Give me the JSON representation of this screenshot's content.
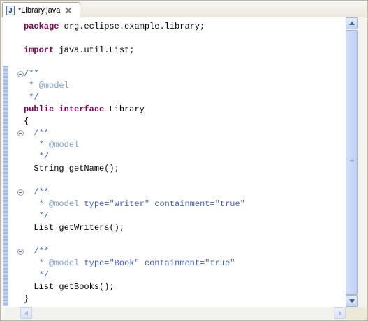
{
  "tab": {
    "icon": "java-file-icon",
    "icon_glyph": "J",
    "label": "*Library.java"
  },
  "code_lines": [
    [
      {
        "t": "package",
        "c": "kw"
      },
      {
        "t": " org.eclipse.example.library;",
        "c": "plain"
      }
    ],
    [],
    [
      {
        "t": "import",
        "c": "kw"
      },
      {
        "t": " java.util.List;",
        "c": "plain"
      }
    ],
    [],
    [
      {
        "t": "/**",
        "c": "doc"
      }
    ],
    [
      {
        "t": " * ",
        "c": "doc"
      },
      {
        "t": "@model",
        "c": "tag"
      }
    ],
    [
      {
        "t": " */",
        "c": "doc"
      }
    ],
    [
      {
        "t": "public",
        "c": "kw"
      },
      {
        "t": " ",
        "c": "plain"
      },
      {
        "t": "interface",
        "c": "kw"
      },
      {
        "t": " Library",
        "c": "plain"
      }
    ],
    [
      {
        "t": "{",
        "c": "plain"
      }
    ],
    [
      {
        "t": "  /**",
        "c": "doc"
      }
    ],
    [
      {
        "t": "   * ",
        "c": "doc"
      },
      {
        "t": "@model",
        "c": "tag"
      }
    ],
    [
      {
        "t": "   */",
        "c": "doc"
      }
    ],
    [
      {
        "t": "  String getName();",
        "c": "plain"
      }
    ],
    [],
    [
      {
        "t": "  /**",
        "c": "doc"
      }
    ],
    [
      {
        "t": "   * ",
        "c": "doc"
      },
      {
        "t": "@model",
        "c": "tag"
      },
      {
        "t": " type=",
        "c": "doc"
      },
      {
        "t": "\"Writer\"",
        "c": "doc"
      },
      {
        "t": " containment=",
        "c": "doc"
      },
      {
        "t": "\"true\"",
        "c": "doc"
      }
    ],
    [
      {
        "t": "   */",
        "c": "doc"
      }
    ],
    [
      {
        "t": "  List getWriters();",
        "c": "plain"
      }
    ],
    [],
    [
      {
        "t": "  /**",
        "c": "doc"
      }
    ],
    [
      {
        "t": "   * ",
        "c": "doc"
      },
      {
        "t": "@model",
        "c": "tag"
      },
      {
        "t": " type=",
        "c": "doc"
      },
      {
        "t": "\"Book\"",
        "c": "doc"
      },
      {
        "t": " containment=",
        "c": "doc"
      },
      {
        "t": "\"true\"",
        "c": "doc"
      }
    ],
    [
      {
        "t": "   */",
        "c": "doc"
      }
    ],
    [
      {
        "t": "  List getBooks();",
        "c": "plain"
      }
    ],
    [
      {
        "t": "}",
        "c": "plain"
      }
    ]
  ],
  "fold_markers_at_lines": [
    4,
    9,
    14,
    19
  ],
  "colors": {
    "keyword": "#7f0055",
    "javadoc": "#3f5fbf",
    "javadoc_tag": "#7f9fbf",
    "plain": "#000000"
  }
}
